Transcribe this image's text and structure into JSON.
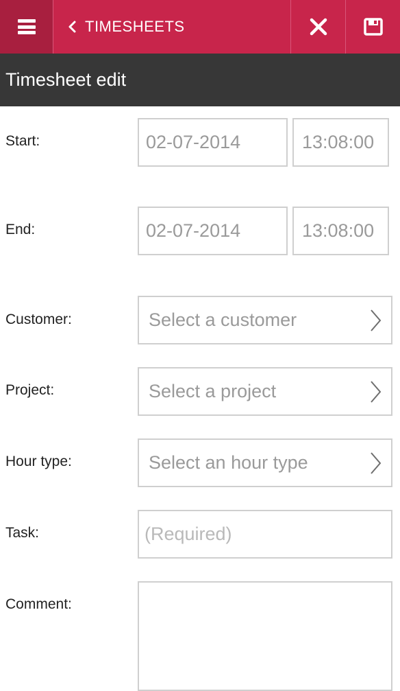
{
  "appbar": {
    "menu_icon": "hamburger-menu-icon",
    "back_icon": "chevron-left-icon",
    "back_label": "TIMESHEETS",
    "close_icon": "close-icon",
    "save_icon": "save-icon",
    "colors": {
      "primary": "#c8254b",
      "primary_dark": "#a81f3f",
      "subheader": "#373737"
    }
  },
  "subheader": {
    "title": "Timesheet edit"
  },
  "form": {
    "start": {
      "label": "Start:",
      "date": "02-07-2014",
      "time": "13:08:00"
    },
    "end": {
      "label": "End:",
      "date": "02-07-2014",
      "time": "13:08:00"
    },
    "customer": {
      "label": "Customer:",
      "value": "Select a customer"
    },
    "project": {
      "label": "Project:",
      "value": "Select a project"
    },
    "hour_type": {
      "label": "Hour type:",
      "value": "Select an hour type"
    },
    "task": {
      "label": "Task:",
      "placeholder": "(Required)"
    },
    "comment": {
      "label": "Comment:",
      "value": ""
    }
  }
}
